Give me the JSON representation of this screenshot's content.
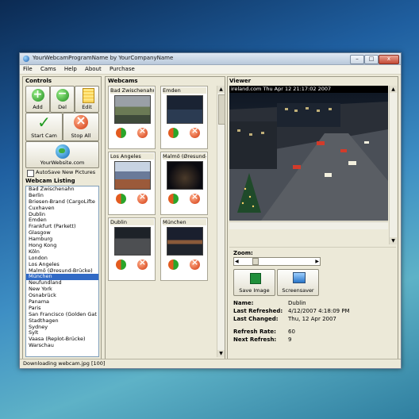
{
  "window": {
    "title": "YourWebcamProgramName by YourCompanyName"
  },
  "menu": [
    "File",
    "Cams",
    "Help",
    "About",
    "Purchase"
  ],
  "controls": {
    "title": "Controls",
    "add": "Add",
    "del": "Del",
    "edit": "Edit",
    "start": "Start Cam",
    "stop": "Stop All",
    "website": "YourWebsite.com",
    "autosave": "AutoSave New Pictures"
  },
  "listing": {
    "title": "Webcam Listing",
    "items": [
      "Bad Zwischenahn",
      "Berlin",
      "Briesen-Brand (CargoLifte",
      "Cuxhaven",
      "Dublin",
      "Emden",
      "Frankfurt (Parkett)",
      "Glasgow",
      "Hamburg",
      "Hong Kong",
      "Köln",
      "London",
      "Los Angeles",
      "Malmö (Øresund-Brücke)",
      "München",
      "Neufundland",
      "New York",
      "Osnabrück",
      "Panama",
      "Paris",
      "San Francisco (Golden Gat",
      "Stadthagen",
      "Sydney",
      "Sylt",
      "Vaasa (Replot-Brücke)",
      "Warschau"
    ],
    "selected_index": 14
  },
  "webcams": {
    "title": "Webcams",
    "cams": [
      "Bad Zwischenahn",
      "Emden",
      "Los Angeles",
      "Malmö (Øresund-",
      "Dublin",
      "München"
    ]
  },
  "viewer": {
    "title": "Viewer",
    "overlay": "ireland.com   Thu Apr 12  21:17:02  2007",
    "zoom_label": "Zoom:",
    "save_image": "Save Image",
    "screensaver": "Screensaver"
  },
  "info": {
    "name_label": "Name:",
    "name": "Dublin",
    "refreshed_label": "Last Refreshed:",
    "refreshed": "4/12/2007 4:18:09 PM",
    "changed_label": "Last Changed:",
    "changed": "Thu, 12 Apr 2007",
    "rate_label": "Refresh Rate:",
    "rate": "60",
    "next_label": "Next Refresh:",
    "next": "9"
  },
  "status": "Downloading webcam.jpg [100]"
}
